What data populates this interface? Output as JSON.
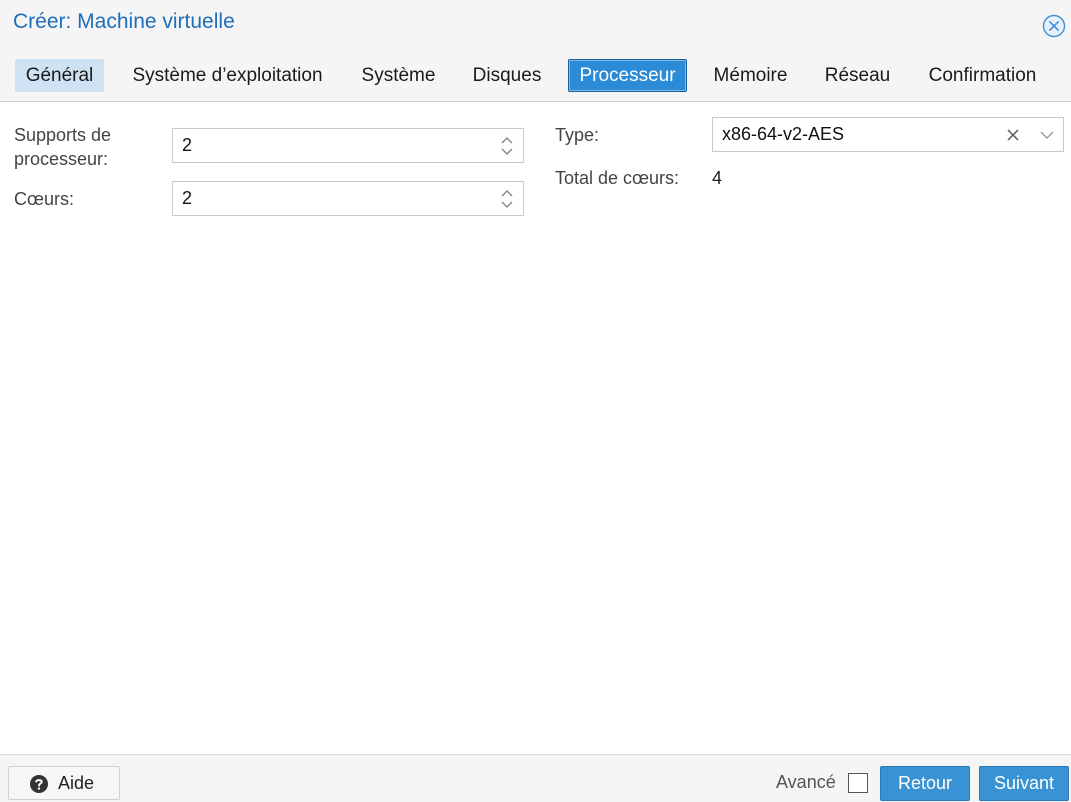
{
  "dialog": {
    "title": "Créer: Machine virtuelle"
  },
  "tabs": [
    {
      "label": "Général"
    },
    {
      "label": "Système d’exploitation"
    },
    {
      "label": "Système"
    },
    {
      "label": "Disques"
    },
    {
      "label": "Processeur",
      "active": true
    },
    {
      "label": "Mémoire"
    },
    {
      "label": "Réseau"
    },
    {
      "label": "Confirmation"
    }
  ],
  "form": {
    "sockets_label_line1": "Supports de",
    "sockets_label_line2": "processeur:",
    "sockets_value": "2",
    "cores_label": "Cœurs:",
    "cores_value": "2",
    "type_label": "Type:",
    "type_value": "x86-64-v2-AES",
    "total_cores_label": "Total de cœurs:",
    "total_cores_value": "4"
  },
  "footer": {
    "help_label": "Aide",
    "advanced_label": "Avancé",
    "advanced_checked": false,
    "back_label": "Retour",
    "next_label": "Suivant"
  },
  "colors": {
    "accent": "#2b8bd6",
    "title": "#1e6fb8",
    "background": "#f5f5f5"
  },
  "icons": {
    "close": "close-circle-icon",
    "help": "question-circle-icon",
    "spinner": "up-down-chevron-icon",
    "clear": "x-icon",
    "dropdown": "chevron-down-icon"
  }
}
